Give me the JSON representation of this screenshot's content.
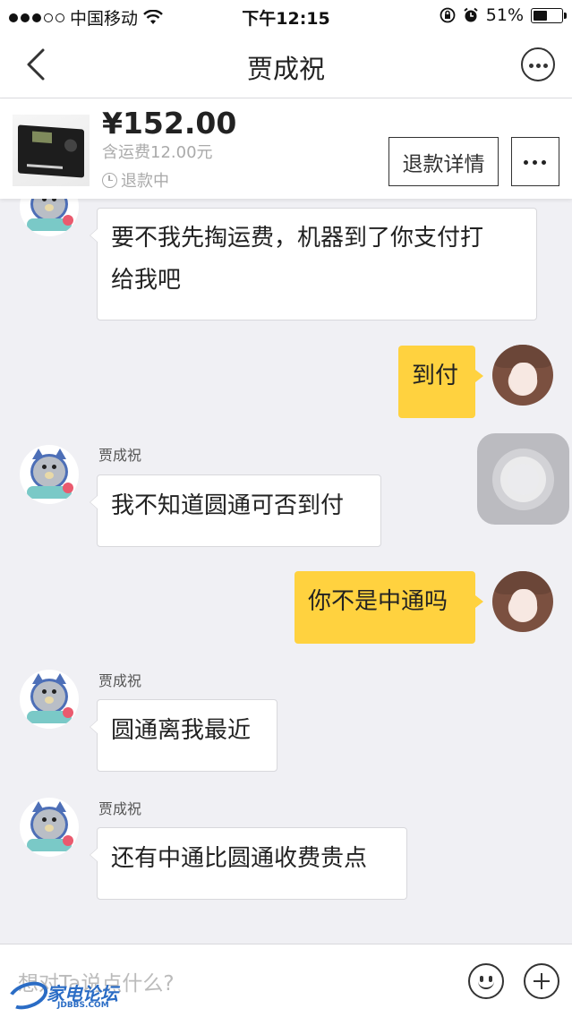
{
  "status_bar": {
    "carrier": "中国移动",
    "time": "下午12:15",
    "battery": "51%",
    "battery_level": 0.51
  },
  "nav": {
    "title": "贾成祝"
  },
  "product": {
    "price": "¥152.00",
    "shipping": "含运费12.00元",
    "status": "退款中",
    "refund_button": "退款详情"
  },
  "messages": [
    {
      "side": "left",
      "sender": "",
      "text_line1": "要不我先掏运费，机器到了你支付打",
      "text_line2": "给我吧"
    },
    {
      "side": "right",
      "text": "到付"
    },
    {
      "side": "left",
      "sender": "贾成祝",
      "text": "我不知道圆通可否到付"
    },
    {
      "side": "right",
      "text": "你不是中通吗"
    },
    {
      "side": "left",
      "sender": "贾成祝",
      "text": "圆通离我最近"
    },
    {
      "side": "left",
      "sender": "贾成祝",
      "text": "还有中通比圆通收费贵点"
    }
  ],
  "input": {
    "placeholder": "想对Ta说点什么?"
  },
  "watermark": {
    "text": "家电论坛",
    "sub": "JDBBS.COM"
  },
  "colors": {
    "own_bubble": "#ffd23f",
    "other_bubble": "#ffffff",
    "background": "#f0f0f4"
  }
}
